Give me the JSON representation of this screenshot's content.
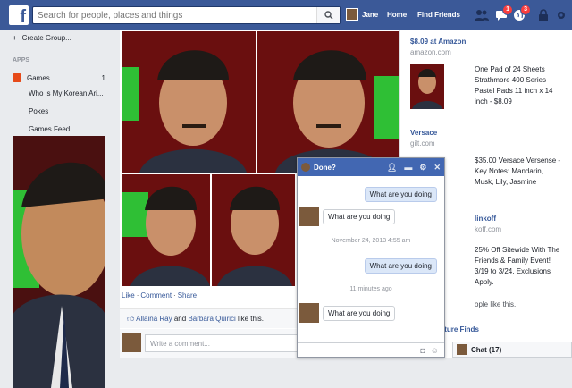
{
  "topbar": {
    "logo": "f",
    "search_placeholder": "Search for people, places and things",
    "user_name": "Jane",
    "home_label": "Home",
    "find_friends_label": "Find Friends",
    "messages_badge": "1",
    "notifications_badge": "3"
  },
  "sidebar": {
    "create_group": "Create Group...",
    "apps_label": "APPS",
    "games_label": "Games",
    "games_count": "1",
    "sub_items": [
      "Who is My Korean Ari...",
      "Pokes",
      "Games Feed"
    ]
  },
  "post": {
    "actions": [
      "Like",
      "Comment",
      "Share"
    ],
    "liker1": "Allaina Ray",
    "and_label": "and",
    "liker2": "Barbara Quirici",
    "like_suffix": "like this.",
    "comment_placeholder": "Write a comment..."
  },
  "ads": [
    {
      "title": "$8.09 at Amazon",
      "domain": "amazon.com",
      "text": "One Pad of 24 Sheets Strathmore 400 Series Pastel Pads 11 inch x 14 inch - $8.09"
    },
    {
      "title": "Versace",
      "domain": "gilt.com",
      "text": "$35.00 Versace Versense - Key Notes: Mandarin, Musk, Lily, Jasmine"
    },
    {
      "title": "linkoff",
      "domain": "koff.com",
      "text": "25% Off Sitewide With The Friends & Family Event! 3/19 to 3/24, Exclusions Apply."
    },
    {
      "title": "rniture Finds",
      "domain": "",
      "text": ""
    }
  ],
  "ad_fragment": "ople like this.",
  "chat": {
    "title": "Done?",
    "messages": [
      {
        "dir": "out",
        "text": "What are you doing"
      },
      {
        "dir": "in",
        "text": "What are you doing"
      },
      {
        "dir": "out",
        "text": "What are you doing"
      },
      {
        "dir": "in",
        "text": "What are you doing"
      }
    ],
    "timestamp1": "November 24, 2013 4:55 am",
    "timestamp2": "11 minutes ago"
  },
  "chatbar": {
    "label": "Chat (17)"
  },
  "colors": {
    "brand": "#3b5998",
    "link": "#365899",
    "badge": "#fa3e3e"
  }
}
